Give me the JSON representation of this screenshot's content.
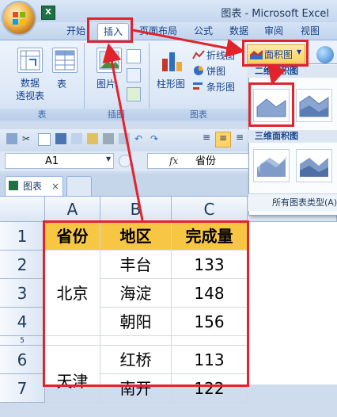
{
  "window": {
    "title": "图表 - Microsoft Excel"
  },
  "tabs": [
    "开始",
    "插入",
    "页面布局",
    "公式",
    "数据",
    "审阅",
    "视图"
  ],
  "ribbon": {
    "pivot_label": "数据\n透视表",
    "table_label": "表",
    "picture_label": "图片",
    "column_chart_label": "柱形图",
    "line_chart_label": "折线图",
    "pie_chart_label": "饼图",
    "bar_chart_label": "条形图",
    "area_chart_label": "面积图",
    "group_tables": "表",
    "group_illustrations": "插图",
    "group_charts": "图表"
  },
  "dropdown": {
    "section_2d": "二维面积图",
    "section_3d": "三维面积图",
    "all_types": "所有图表类型(A)..."
  },
  "formula_bar": {
    "name_box": "A1",
    "fx": "fx",
    "content": "省份"
  },
  "sheet": {
    "tab_name": "图表",
    "tab_close": "×"
  },
  "columns": [
    "A",
    "B",
    "C"
  ],
  "rows": [
    "1",
    "2",
    "3",
    "4",
    "5",
    "6",
    "7"
  ],
  "table": {
    "headers": [
      "省份",
      "地区",
      "完成量"
    ],
    "province_1": "北京",
    "province_2": "天津",
    "data": [
      [
        "丰台",
        "133"
      ],
      [
        "海淀",
        "148"
      ],
      [
        "朝阳",
        "156"
      ],
      [
        "",
        ""
      ],
      [
        "红桥",
        "113"
      ],
      [
        "南开",
        "122"
      ]
    ]
  },
  "colors": {
    "accent_red": "#e3232c",
    "header_fill": "#f7c744"
  }
}
